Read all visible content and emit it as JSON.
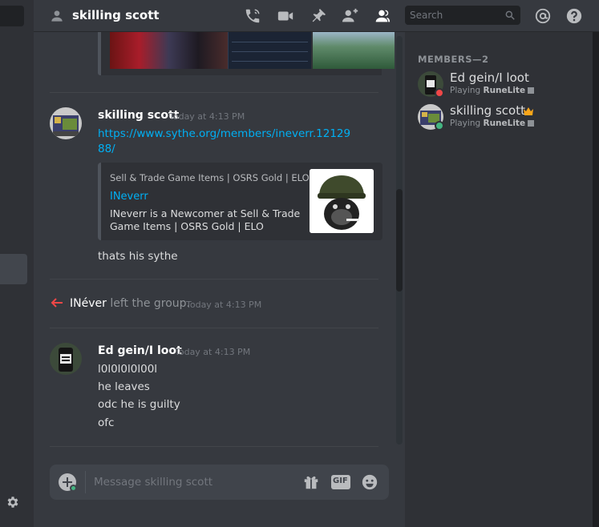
{
  "header": {
    "title": "skilling scott",
    "search_placeholder": "Search"
  },
  "messages": [
    {
      "author": "skilling scott",
      "timestamp": "Today at 4:13 PM",
      "link": "https://www.sythe.org/members/ineverr.1212988/",
      "embed": {
        "provider": "Sell & Trade Game Items | OSRS Gold | ELO",
        "title": "INeverr",
        "description": "INeverr is a Newcomer at Sell & Trade Game Items | OSRS Gold | ELO"
      },
      "text": "thats his sythe"
    },
    {
      "system_user": "INéver",
      "system_action": "left the group.",
      "timestamp": "Today at 4:13 PM"
    },
    {
      "author": "Ed gein/I loot",
      "timestamp": "Today at 4:13 PM",
      "lines": [
        "l0l0l0l0l00l",
        "he leaves",
        "odc he is guilty",
        "ofc"
      ]
    }
  ],
  "input": {
    "placeholder": "Message skilling scott",
    "gif_label": "GIF"
  },
  "members": {
    "title": "MEMBERS—2",
    "list": [
      {
        "name": "Ed gein/I loot",
        "activity_prefix": "Playing",
        "activity": "RuneLite",
        "status_color": "#f04747"
      },
      {
        "name": "skilling scott",
        "activity_prefix": "Playing",
        "activity": "RuneLite",
        "status_color": "#43b581"
      }
    ]
  },
  "colors": {
    "accent_link": "#00b0f4",
    "online": "#43b581",
    "dnd": "#f04747",
    "owner_crown": "#faa61a"
  },
  "icons": [
    "call-icon",
    "video-icon",
    "pin-icon",
    "add-friend-icon",
    "members-icon",
    "search-icon",
    "mention-icon",
    "help-icon",
    "gift-icon",
    "gif-icon",
    "emoji-icon",
    "settings-icon",
    "leave-arrow-icon",
    "crown-icon"
  ]
}
